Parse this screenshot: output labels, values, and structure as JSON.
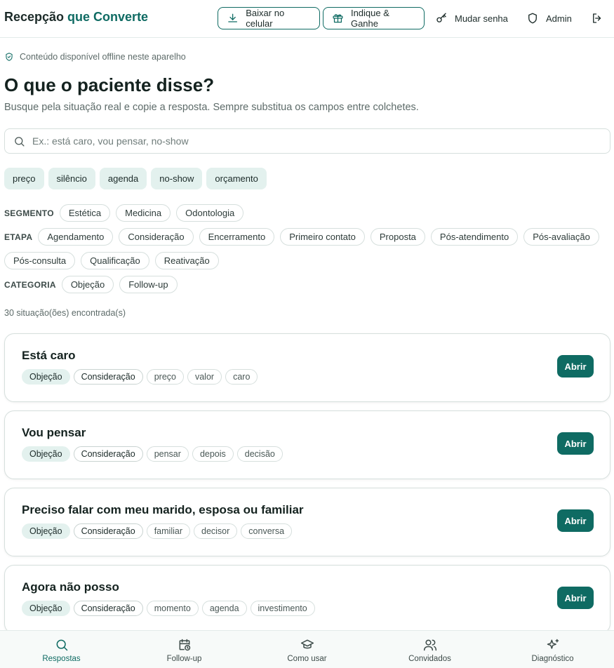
{
  "header": {
    "brand_start": "Recepção ",
    "brand_accent": "que Converte",
    "download_label": "Baixar no celular",
    "refer_label": "Indique & Ganhe",
    "password_label": "Mudar senha",
    "admin_label": "Admin",
    "icons": {
      "download": "download-icon",
      "refer": "gift-icon",
      "password": "key-icon",
      "admin": "shield-icon",
      "logout": "logout-icon"
    }
  },
  "offline_notice": "Conteúdo disponível offline neste aparelho",
  "page": {
    "title": "O que o paciente disse?",
    "subtitle": "Busque pela situação real e copie a resposta. Sempre substitua os campos entre colchetes."
  },
  "search": {
    "placeholder": "Ex.: está caro, vou pensar, no-show",
    "value": ""
  },
  "quick_filters": [
    "preço",
    "silêncio",
    "agenda",
    "no-show",
    "orçamento"
  ],
  "filters": {
    "segment_label": "SEGMENTO",
    "segments": [
      "Estética",
      "Medicina",
      "Odontologia"
    ],
    "stage_label": "ETAPA",
    "stages": [
      "Agendamento",
      "Consideração",
      "Encerramento",
      "Primeiro contato",
      "Proposta",
      "Pós-atendimento",
      "Pós-avaliação",
      "Pós-consulta",
      "Qualificação",
      "Reativação"
    ],
    "category_label": "CATEGORIA",
    "categories": [
      "Objeção",
      "Follow-up"
    ]
  },
  "results_count": "30 situação(ões) encontrada(s)",
  "open_label": "Abrir",
  "cards": [
    {
      "title": "Está caro",
      "category": "Objeção",
      "stage": "Consideração",
      "tags": [
        "preço",
        "valor",
        "caro"
      ]
    },
    {
      "title": "Vou pensar",
      "category": "Objeção",
      "stage": "Consideração",
      "tags": [
        "pensar",
        "depois",
        "decisão"
      ]
    },
    {
      "title": "Preciso falar com meu marido, esposa ou familiar",
      "category": "Objeção",
      "stage": "Consideração",
      "tags": [
        "familiar",
        "decisor",
        "conversa"
      ]
    },
    {
      "title": "Agora não posso",
      "category": "Objeção",
      "stage": "Consideração",
      "tags": [
        "momento",
        "agenda",
        "investimento"
      ]
    }
  ],
  "bottom_nav": [
    {
      "label": "Respostas",
      "icon": "search-icon",
      "active": true
    },
    {
      "label": "Follow-up",
      "icon": "calendar-clock-icon",
      "active": false
    },
    {
      "label": "Como usar",
      "icon": "graduation-cap-icon",
      "active": false
    },
    {
      "label": "Convidados",
      "icon": "users-icon",
      "active": false
    },
    {
      "label": "Diagnóstico",
      "icon": "sparkles-icon",
      "active": false
    }
  ],
  "colors": {
    "accent": "#0f6b63",
    "chip_bg": "#e3f1ee",
    "border": "#d6dfdd"
  }
}
